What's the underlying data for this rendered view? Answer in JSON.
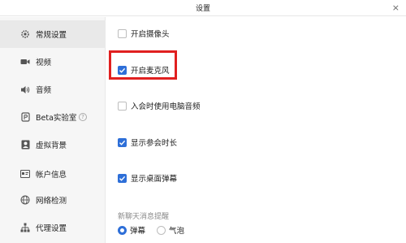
{
  "window": {
    "title": "设置",
    "close_glyph": "×"
  },
  "sidebar": {
    "items": [
      {
        "label": "常规设置",
        "icon": "gear-icon"
      },
      {
        "label": "视频",
        "icon": "camera-icon"
      },
      {
        "label": "音频",
        "icon": "speaker-icon"
      },
      {
        "label": "Beta实验室",
        "icon": "beta-lab-icon",
        "help": "?"
      },
      {
        "label": "虚拟背景",
        "icon": "portrait-icon"
      },
      {
        "label": "帐户信息",
        "icon": "card-icon"
      },
      {
        "label": "网络检测",
        "icon": "globe-icon"
      },
      {
        "label": "代理设置",
        "icon": "network-icon"
      }
    ]
  },
  "options": [
    {
      "label": "开启摄像头",
      "checked": false
    },
    {
      "label": "开启麦克风",
      "checked": true
    },
    {
      "label": "入会时使用电脑音频",
      "checked": false
    },
    {
      "label": "显示参会时长",
      "checked": true
    },
    {
      "label": "显示桌面弹幕",
      "checked": true
    }
  ],
  "chat_reminder": {
    "title": "新聊天消息提醒",
    "options": [
      {
        "label": "弹幕",
        "selected": true
      },
      {
        "label": "气泡",
        "selected": false
      }
    ]
  },
  "colors": {
    "accent": "#2e6fd8",
    "highlight": "#e02020"
  }
}
